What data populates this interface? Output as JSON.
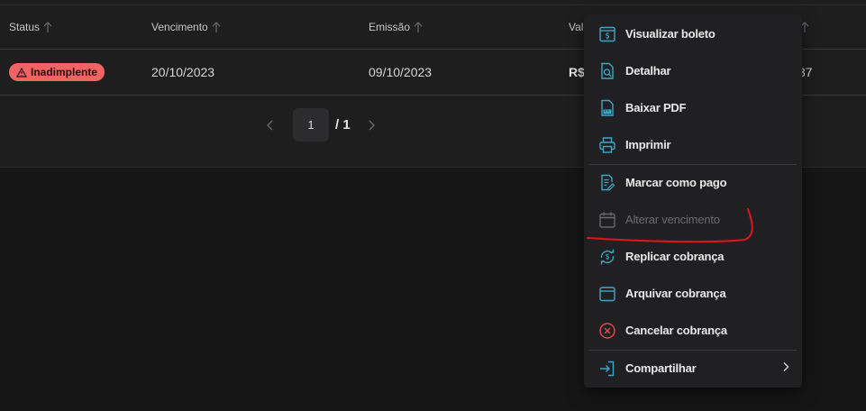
{
  "table": {
    "headers": {
      "status": "Status",
      "vencimento": "Vencimento",
      "emissao": "Emissão",
      "valor": "Val"
    },
    "row": {
      "status_badge": "Inadimplente",
      "vencimento": "20/10/2023",
      "emissao": "09/10/2023",
      "valor_partial": "R$",
      "trailing_partial": "37"
    }
  },
  "pagination": {
    "current_page": "1",
    "total_label": "/ 1"
  },
  "context_menu": {
    "items": [
      {
        "label": "Visualizar boleto",
        "icon": "boleto-view-icon"
      },
      {
        "label": "Detalhar",
        "icon": "document-search-icon"
      },
      {
        "label": "Baixar PDF",
        "icon": "pdf-file-icon"
      },
      {
        "label": "Imprimir",
        "icon": "printer-icon"
      },
      {
        "label": "Marcar como pago",
        "icon": "document-edit-icon"
      },
      {
        "label": "Alterar vencimento",
        "icon": "calendar-icon",
        "disabled": true
      },
      {
        "label": "Replicar cobrança",
        "icon": "replicate-money-icon"
      },
      {
        "label": "Arquivar cobrança",
        "icon": "archive-box-icon"
      },
      {
        "label": "Cancelar cobrança",
        "icon": "cancel-circle-icon"
      },
      {
        "label": "Compartilhar",
        "icon": "share-export-icon",
        "has_submenu": true
      }
    ]
  },
  "colors": {
    "accent": "#3aa7c9",
    "danger_badge": "#f26464",
    "cancel_icon": "#e5484d",
    "annotation_stroke": "#e0141c"
  }
}
